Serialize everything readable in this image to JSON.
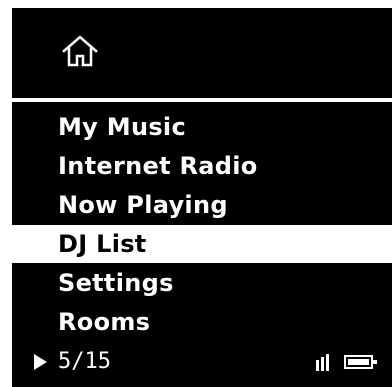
{
  "home": {
    "icon": "home-icon"
  },
  "menu": {
    "items": [
      {
        "label": "My Music"
      },
      {
        "label": "Internet Radio"
      },
      {
        "label": "Now Playing"
      },
      {
        "label": "DJ List"
      },
      {
        "label": "Settings"
      },
      {
        "label": "Rooms"
      }
    ],
    "selected_index": 3
  },
  "status": {
    "track_position": "5/15",
    "play_icon": "play-icon",
    "signal_icon": "signal-icon",
    "battery_icon": "battery-icon"
  },
  "colors": {
    "background": "#000000",
    "foreground": "#FFFFFF",
    "selected_background": "#FFFFFF",
    "selected_foreground": "#000000"
  }
}
